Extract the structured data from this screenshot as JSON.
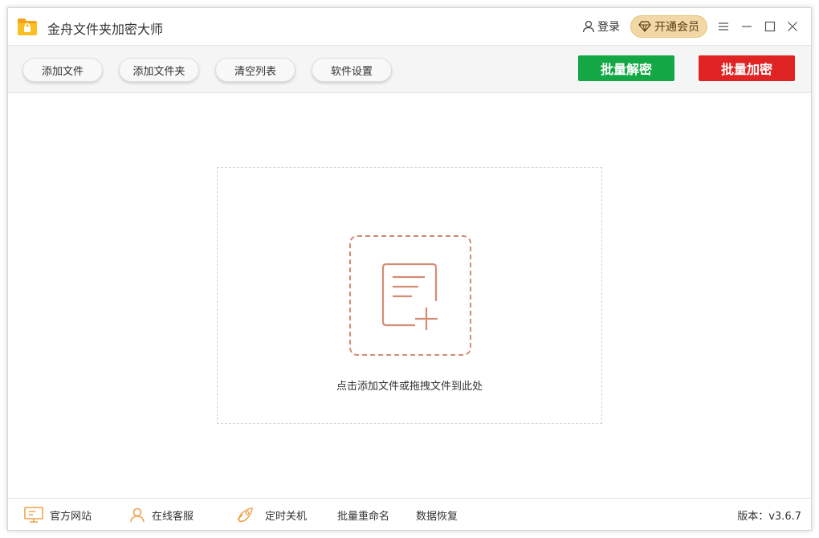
{
  "app": {
    "title": "金舟文件夹加密大师"
  },
  "header": {
    "login_label": "登录",
    "vip_label": "开通会员"
  },
  "toolbar": {
    "buttons": [
      "添加文件",
      "添加文件夹",
      "清空列表",
      "软件设置"
    ],
    "decrypt_label": "批量解密",
    "encrypt_label": "批量加密"
  },
  "main": {
    "drop_hint": "点击添加文件或拖拽文件到此处"
  },
  "footer": {
    "items": [
      "官方网站",
      "在线客服",
      "定时关机",
      "批量重命名",
      "数据恢复"
    ],
    "version": "版本：v3.6.7"
  },
  "colors": {
    "accent_orange": "#d48c72",
    "decrypt_green": "#13a845",
    "encrypt_red": "#e02424",
    "vip_gold": "#f1d8a6"
  }
}
